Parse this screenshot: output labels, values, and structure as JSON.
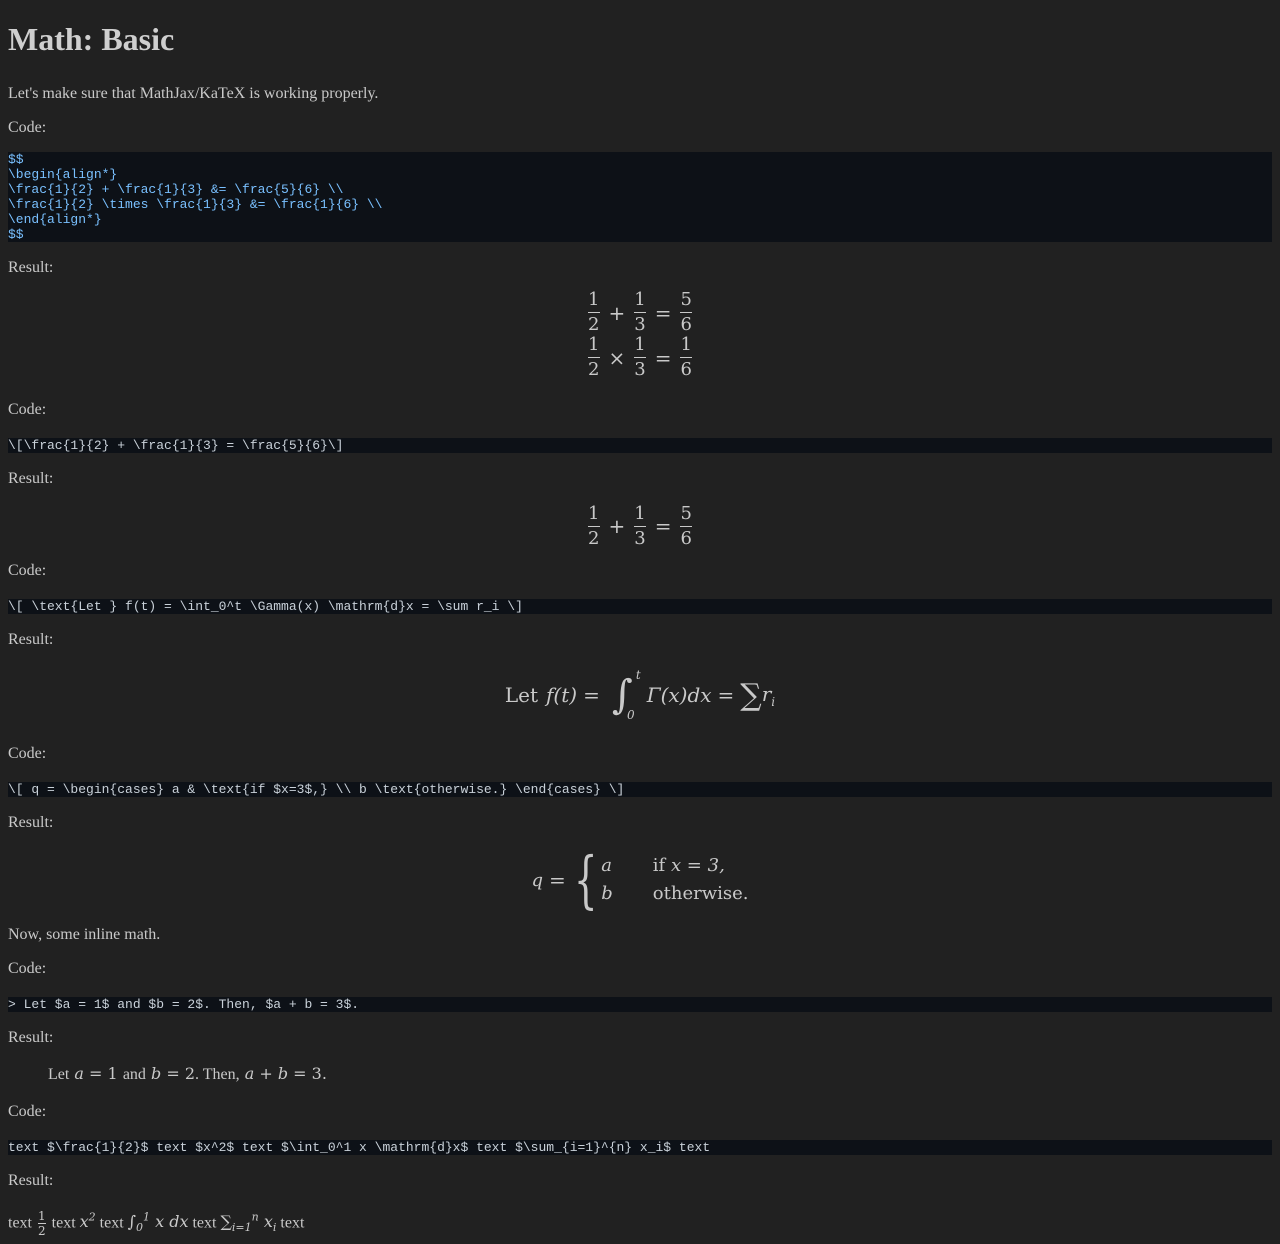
{
  "title": "Math: Basic",
  "intro": "Let's make sure that MathJax/KaTeX is working properly.",
  "labels": {
    "code": "Code:",
    "result": "Result:"
  },
  "inline_intro": "Now, some inline math.",
  "code1": [
    "$$",
    "\\begin{align*}",
    "\\frac{1}{2} + \\frac{1}{3} &= \\frac{5}{6} \\\\",
    "\\frac{1}{2} \\times \\frac{1}{3} &= \\frac{1}{6} \\\\",
    "\\end{align*}",
    "$$"
  ],
  "code2": "\\[\\frac{1}{2} + \\frac{1}{3} = \\frac{5}{6}\\]",
  "code3": "\\[ \\text{Let } f(t) = \\int_0^t \\Gamma(x) \\mathrm{d}x = \\sum r_i \\]",
  "code4": "\\[ q = \\begin{cases} a & \\text{if $x=3$,} \\\\ b \\text{otherwise.} \\end{cases} \\]",
  "code5": "> Let $a = 1$ and $b = 2$. Then, $a + b = 3$.",
  "code6": "text $\\frac{1}{2}$ text $x^2$ text $\\int_0^1 x \\mathrm{d}x$ text $\\sum_{i=1}^{n} x_i$ text",
  "result5": {
    "let": "Let",
    "and": "and",
    "then": ". Then,",
    "end": "."
  },
  "result6": {
    "text": "text"
  },
  "math": {
    "one": "1",
    "two": "2",
    "three": "3",
    "five": "5",
    "six": "6",
    "plus": "+",
    "eq": "=",
    "times": "×",
    "let_text": "Let",
    "f_t": "f(t)",
    "gamma": "Γ(x)dx",
    "sum": "∑",
    "r_i": "r",
    "q": "q",
    "a": "a",
    "b": "b",
    "if_text": "if",
    "x_eq_3": "x = 3,",
    "otherwise": "otherwise."
  }
}
